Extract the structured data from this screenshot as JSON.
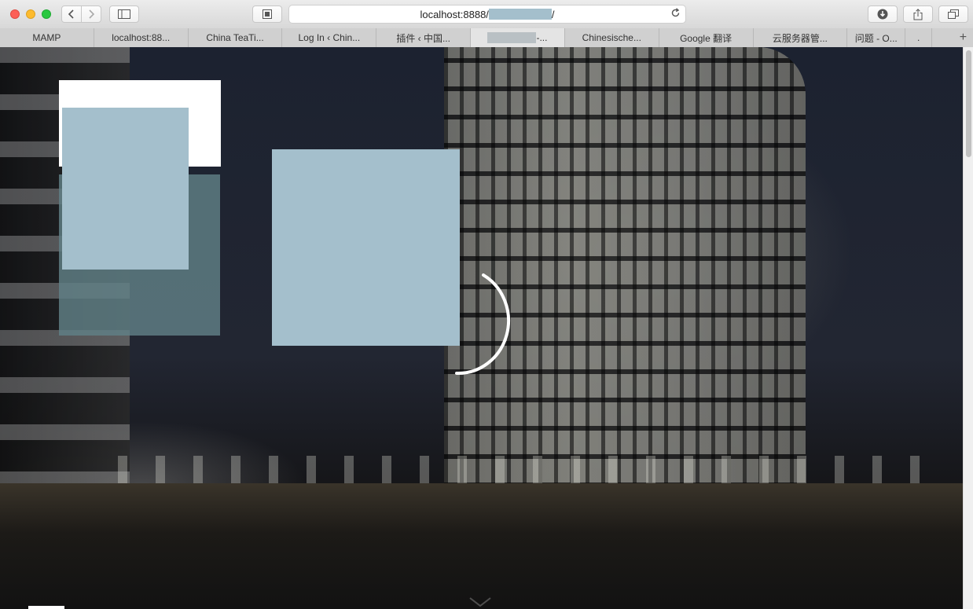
{
  "browser": {
    "url_prefix": "localhost:8888/",
    "url_suffix": "/",
    "tabs": [
      {
        "label": "MAMP"
      },
      {
        "label": "localhost:88..."
      },
      {
        "label": "China TeaTi..."
      },
      {
        "label": "Log In ‹ Chin..."
      },
      {
        "label": "插件 ‹ 中国..."
      },
      {
        "label": "-..."
      },
      {
        "label": "Chinesische..."
      },
      {
        "label": "Google 翻译"
      },
      {
        "label": "云服务器管..."
      },
      {
        "label": "问题 - O..."
      },
      {
        "label": "."
      }
    ],
    "new_tab_symbol": "+"
  },
  "icons": {
    "back": "chevron-left-icon",
    "forward": "chevron-right-icon",
    "sidebar": "sidebar-icon",
    "reader": "reader-icon",
    "reload": "reload-icon",
    "download": "download-icon",
    "share": "share-icon",
    "tabs": "tabs-overview-icon"
  },
  "colors": {
    "placeholder_blue": "#a4bfcc",
    "overlay_teal": "#608086"
  }
}
